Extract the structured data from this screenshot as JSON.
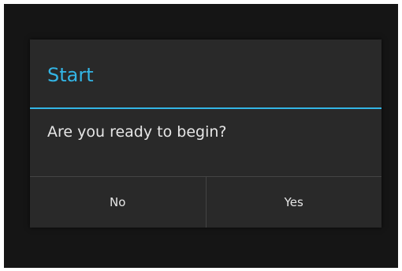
{
  "dialog": {
    "title": "Start",
    "message": "Are you ready to begin?",
    "buttons": {
      "negative_label": "No",
      "positive_label": "Yes"
    }
  },
  "colors": {
    "accent": "#33b5e5",
    "dialog_background": "#292929",
    "screen_background": "#151515",
    "text": "#e6e6e6",
    "divider": "#444444"
  }
}
